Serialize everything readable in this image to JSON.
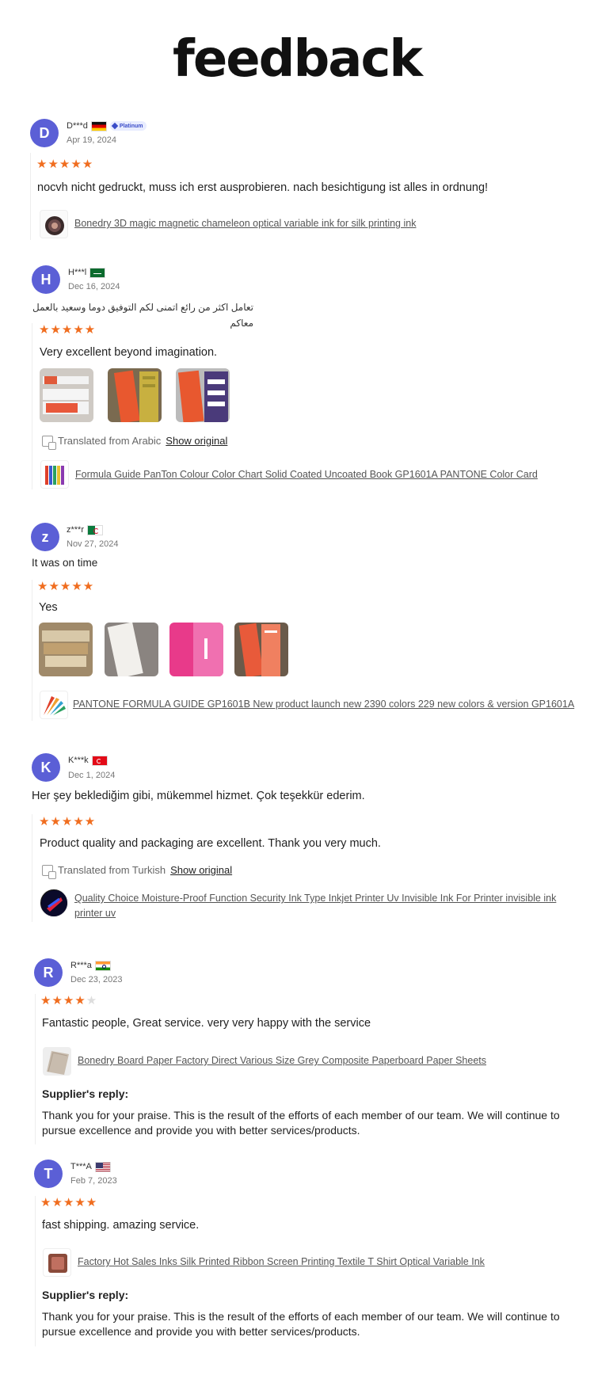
{
  "page": {
    "title": "feedback"
  },
  "colors": {
    "avatar": "#5b5fd6",
    "star": "#f06d1f",
    "badge": "#3a4cc8"
  },
  "reviews": [
    {
      "initial": "D",
      "name": "D***d",
      "flag": "flag-de",
      "badge": "Platinum",
      "date": "Apr 19, 2024",
      "rating": 5,
      "text": "nocvh nicht gedruckt, muss ich erst ausprobieren. nach besichtigung ist alles in ordnung!",
      "product": "Bonedry 3D magic magnetic chameleon optical variable ink for silk printing ink"
    },
    {
      "initial": "H",
      "name": "H***l",
      "flag": "flag-sa",
      "date": "Dec 16, 2024",
      "comment": "تعامل اكثر من رائع اتمنى لكم التوفيق دوما وسعيد بالعمل معاكم",
      "rating": 5,
      "text": "Very excellent beyond imagination.",
      "translated": "Translated from Arabic",
      "show_original": "Show original",
      "product": "Formula Guide PanTon Colour Color Chart Solid Coated Uncoated Book GP1601A PANTONE Color Card"
    },
    {
      "initial": "z",
      "name": "z***r",
      "flag": "flag-dz",
      "date": "Nov 27, 2024",
      "comment": "It was on time",
      "rating": 5,
      "text": "Yes",
      "product": "PANTONE FORMULA GUIDE GP1601B New product launch new 2390 colors 229 new colors & version GP1601A"
    },
    {
      "initial": "K",
      "name": "K***k",
      "flag": "flag-tr",
      "date": "Dec 1, 2024",
      "comment": "Her şey beklediğim gibi, mükemmel hizmet. Çok teşekkür ederim.",
      "rating": 5,
      "text": "Product quality and packaging are excellent. Thank you very much.",
      "translated": "Translated from Turkish",
      "show_original": "Show original",
      "product": "Quality Choice Moisture-Proof Function Security Ink Type Inkjet Printer Uv Invisible Ink For Printer invisible ink printer uv"
    },
    {
      "initial": "R",
      "name": "R***a",
      "flag": "flag-in",
      "date": "Dec 23, 2023",
      "rating": 4,
      "text": "Fantastic people, Great service. very very happy with the service",
      "product": "Bonedry Board Paper Factory Direct Various Size Grey Composite Paperboard Paper Sheets",
      "reply_title": "Supplier's reply:",
      "reply_text": "Thank you for your praise. This is the result of the efforts of each member of our team. We will continue to pursue excellence and provide you with better services/products."
    },
    {
      "initial": "T",
      "name": "T***A",
      "flag": "flag-us",
      "date": "Feb 7, 2023",
      "rating": 5,
      "text": "fast shipping. amazing service.",
      "product": "Factory Hot Sales Inks Silk Printed Ribbon Screen Printing Textile T Shirt Optical Variable Ink",
      "reply_title": "Supplier's reply:",
      "reply_text": "Thank you for your praise. This is the result of the efforts of each member of our team. We will continue to pursue excellence and provide you with better services/products."
    }
  ]
}
